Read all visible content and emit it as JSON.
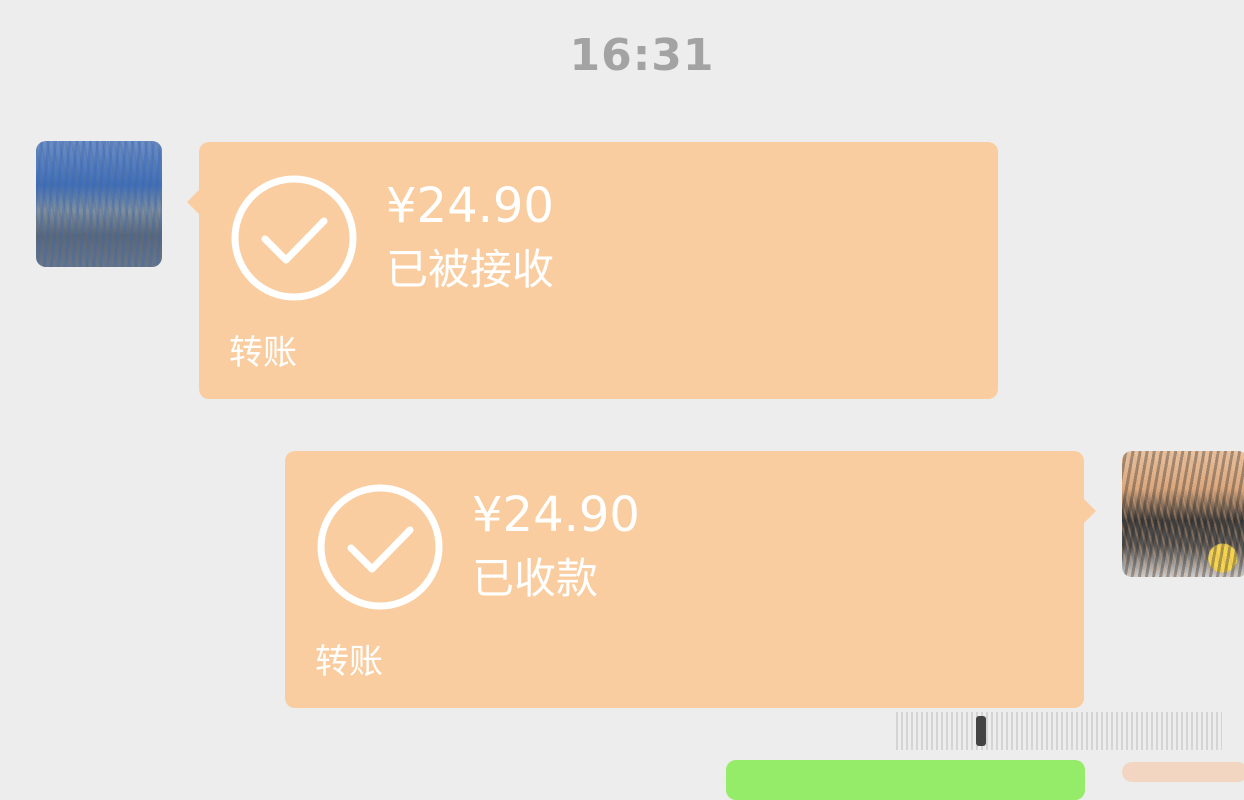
{
  "chat": {
    "timestamp": "16:31",
    "messages": [
      {
        "side": "left",
        "type": "transfer",
        "amount": "¥24.90",
        "status": "已被接收",
        "label": "转账",
        "icon": "check-circle-icon"
      },
      {
        "side": "right",
        "type": "transfer",
        "amount": "¥24.90",
        "status": "已收款",
        "label": "转账",
        "icon": "check-circle-icon"
      }
    ]
  },
  "colors": {
    "background": "#ededed",
    "transfer_bubble": "#f9cd9f",
    "sent_text_bubble": "#95ec69",
    "timestamp_text": "#a3a3a3",
    "bubble_text": "#ffffff"
  }
}
